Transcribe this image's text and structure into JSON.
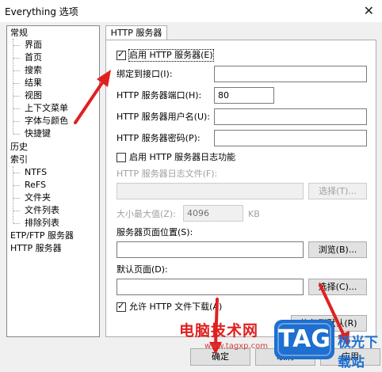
{
  "window": {
    "title": "Everything 选项",
    "close_glyph": "✕"
  },
  "tree": {
    "groups": [
      {
        "label": "常规",
        "children": [
          "界面",
          "首页",
          "搜索",
          "结果",
          "视图",
          "上下文菜单",
          "字体与颜色",
          "快捷键"
        ]
      },
      {
        "label": "历史"
      },
      {
        "label": "索引",
        "children": [
          "NTFS",
          "ReFS",
          "文件夹",
          "文件列表",
          "排除列表"
        ]
      },
      {
        "label": "ETP/FTP 服务器"
      },
      {
        "label": "HTTP 服务器",
        "selected": true
      }
    ]
  },
  "tab": {
    "label": "HTTP 服务器"
  },
  "settings": {
    "enable_http": {
      "label": "启用 HTTP 服务器(E)",
      "checked": true
    },
    "bind_interface": {
      "label": "绑定到接口(I):",
      "value": ""
    },
    "port": {
      "label": "HTTP 服务器端口(H):",
      "value": "80"
    },
    "username": {
      "label": "HTTP 服务器用户名(U):",
      "value": ""
    },
    "password": {
      "label": "HTTP 服务器密码(P):",
      "value": ""
    },
    "enable_log": {
      "label": "启用 HTTP 服务器日志功能",
      "checked": false
    },
    "log_file": {
      "label": "HTTP 服务器日志文件(F):",
      "value": "",
      "browse_label": "选择(T)..."
    },
    "max_size": {
      "label": "大小最大值(Z):",
      "value": "4096",
      "unit": "KB"
    },
    "page_location": {
      "label": "服务器页面位置(S):",
      "value": "",
      "browse_label": "浏览(B)..."
    },
    "default_page": {
      "label": "默认页面(D):",
      "value": "",
      "browse_label": "选择(C)..."
    },
    "allow_download": {
      "label": "允许 HTTP 文件下载(A)",
      "checked": true
    },
    "restore_defaults": {
      "label": "恢复到默认(R)"
    }
  },
  "footer": {
    "ok_label": "确定",
    "cancel_label": "取消",
    "apply_label": "应用"
  },
  "watermark": {
    "text": "电脑技术网",
    "url": "www.tagxp.com",
    "badge": "TAG",
    "site": "极光下载站"
  },
  "colors": {
    "arrow": "#e02020",
    "watermark_red": "#e02020",
    "badge_blue": "#1e6fd0"
  }
}
